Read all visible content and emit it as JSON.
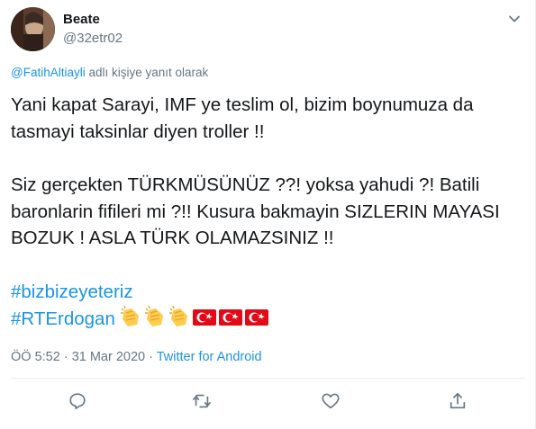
{
  "tweet": {
    "author": {
      "name": "Beate",
      "handle": "@32etr02"
    },
    "reply_to": {
      "mention": "@FatihAltiayli",
      "suffix": " adlı kişiye yanıt olarak"
    },
    "paragraphs": [
      "Yani kapat Sarayi, IMF ye teslim ol, bizim boynumuza da tasmayi taksinlar diyen troller !!",
      "Siz gerçekten TÜRKMÜSÜNÜZ ??! yoksa yahudi ?! Batili baronlarin fifileri mi ?!! Kusura bakmayin SIZLERIN MAYASI BOZUK ! ASLA TÜRK OLAMAZSINIZ !!"
    ],
    "hashtags": [
      "#bizbizeyeteriz",
      "#RTErdogan"
    ],
    "emojis": [
      "clapping-hands-emoji",
      "clapping-hands-emoji",
      "clapping-hands-emoji",
      "turkey-flag-emoji",
      "turkey-flag-emoji",
      "turkey-flag-emoji"
    ],
    "timestamp": "ÖÖ 5:52 · 31 Mar 2020",
    "separator": " · ",
    "source": "Twitter for Android",
    "actions": [
      "reply-icon",
      "retweet-icon",
      "like-icon",
      "share-icon"
    ],
    "colors": {
      "link": "#1b95e0",
      "secondary": "#657786",
      "text": "#14171a",
      "flag": "#e30a17"
    }
  }
}
